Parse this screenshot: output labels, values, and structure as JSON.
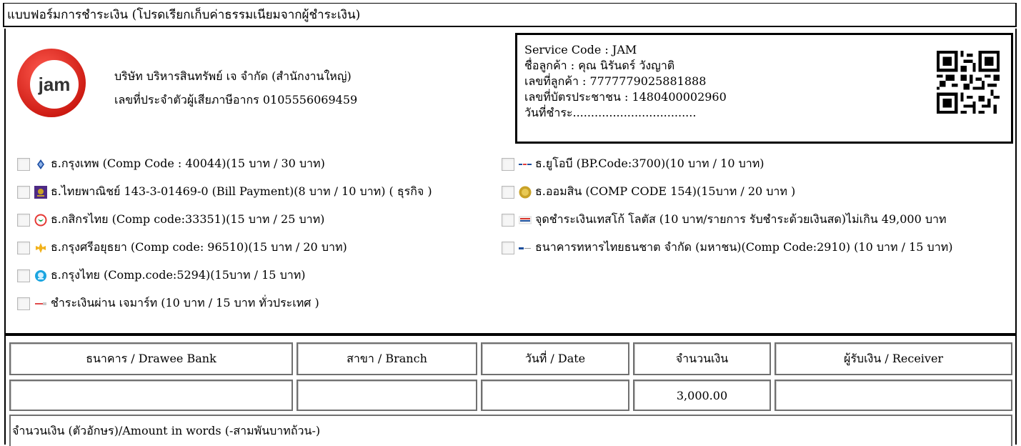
{
  "form": {
    "title": "แบบฟอร์มการชำระเงิน (โปรดเรียกเก็บค่าธรรมเนียมจากผู้ชำระเงิน)"
  },
  "company": {
    "logo_text": "jam",
    "name": "บริษัท บริหารสินทรัพย์ เจ จำกัด (สำนักงานใหญ่)",
    "tax_id": "เลขที่ประจำตัวผู้เสียภาษีอากร 0105556069459"
  },
  "customer": {
    "service_code": "Service Code : JAM",
    "name": "ชื่อลูกค้า : คุณ นิรันดร์ วังญาติ",
    "customer_no": "เลขที่ลูกค้า : 7777779025881888",
    "citizen_id": "เลขที่บัตรประชาชน : 1480400002960",
    "pay_date": "วันที่ชำระ.................................."
  },
  "banks_left": [
    {
      "icon": "bangkok-bank-icon",
      "label": "ธ.กรุงเทพ (Comp Code : 40044)(15 บาท / 30 บาท)",
      "color": "#1e4fa3"
    },
    {
      "icon": "scb-icon",
      "label": "ธ.ไทยพาณิชย์ 143-3-01469-0 (Bill Payment)(8 บาท / 10 บาท) ( ธุรกิจ )",
      "color": "#4e2a84"
    },
    {
      "icon": "kasikorn-icon",
      "label": "ธ.กสิกรไทย (Comp code:33351)(15 บาท / 25 บาท)",
      "color": "#1aa34a"
    },
    {
      "icon": "krungsri-icon",
      "label": "ธ.กรุงศรีอยุธยา (Comp code: 96510)(15 บาท / 20 บาท)",
      "color": "#f2b21b"
    },
    {
      "icon": "krungthai-icon",
      "label": "ธ.กรุงไทย (Comp.code:5294)(15บาท / 15 บาท)",
      "color": "#1ba5e0"
    },
    {
      "icon": "jmart-icon",
      "label": "ชำระเงินผ่าน เจมาร์ท (10 บาท / 15 บาท ทั่วประเทศ )",
      "color": "#e04b4b"
    }
  ],
  "banks_right": [
    {
      "icon": "uob-icon",
      "label": "ธ.ยูโอบี (BP.Code:3700)(10 บาท / 10 บาท)",
      "color": "#e03a3a"
    },
    {
      "icon": "gsb-icon",
      "label": "ธ.ออมสิน (COMP CODE 154)(15บาท / 20 บาท )",
      "color": "#c9a227"
    },
    {
      "icon": "tesco-lotus-icon",
      "label": "จุดชำระเงินเทสโก้ โลตัส (10 บาท/รายการ รับชำระด้วยเงินสด)ไม่เกิน 49,000 บาท",
      "color": "#d9342b"
    },
    {
      "icon": "ttb-icon",
      "label": "ธนาคารทหารไทยธนชาต จำกัด (มหาชน)(Comp Code:2910) (10 บาท / 15 บาท)",
      "color": "#1f4f9c"
    }
  ],
  "table": {
    "headers": [
      "ธนาคาร / Drawee Bank",
      "สาขา / Branch",
      "วันที่ / Date",
      "จำนวนเงิน",
      "ผู้รับเงิน / Receiver"
    ],
    "amount": "3,000.00"
  },
  "amount_words": "จำนวนเงิน (ตัวอักษร)/Amount in words (-สามพันบาทถ้วน-)",
  "colors": {
    "logo_red": "#e2231a",
    "border": "#000000"
  }
}
